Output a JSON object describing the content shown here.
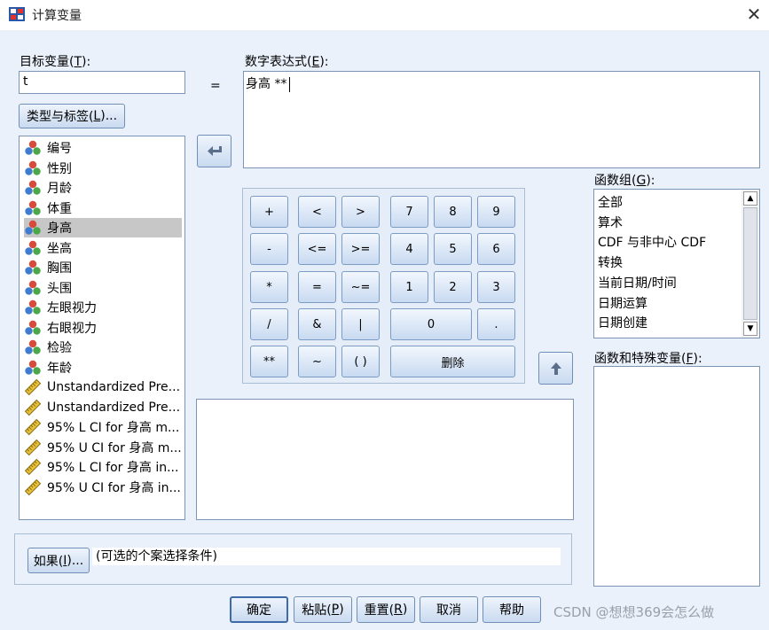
{
  "window": {
    "title": "计算变量"
  },
  "target": {
    "label": "目标变量(T):",
    "value": "t",
    "type_button": "类型与标签(L)..."
  },
  "equals": "=",
  "expression": {
    "label": "数字表达式(E):",
    "value": "身高 **"
  },
  "variables": [
    {
      "name": "编号",
      "kind": "nominal"
    },
    {
      "name": "性别",
      "kind": "nominal"
    },
    {
      "name": "月龄",
      "kind": "nominal"
    },
    {
      "name": "体重",
      "kind": "nominal"
    },
    {
      "name": "身高",
      "kind": "nominal",
      "selected": true
    },
    {
      "name": "坐高",
      "kind": "nominal"
    },
    {
      "name": "胸围",
      "kind": "nominal"
    },
    {
      "name": "头围",
      "kind": "nominal"
    },
    {
      "name": "左眼视力",
      "kind": "nominal"
    },
    {
      "name": "右眼视力",
      "kind": "nominal"
    },
    {
      "name": "检验",
      "kind": "nominal"
    },
    {
      "name": "年龄",
      "kind": "nominal"
    },
    {
      "name": "Unstandardized Pre...",
      "kind": "scale"
    },
    {
      "name": "Unstandardized Pre...",
      "kind": "scale"
    },
    {
      "name": "95% L CI for 身高 m...",
      "kind": "scale"
    },
    {
      "name": "95% U CI for 身高 m...",
      "kind": "scale"
    },
    {
      "name": "95% L CI for 身高 in...",
      "kind": "scale"
    },
    {
      "name": "95% U CI for 身高 in...",
      "kind": "scale"
    }
  ],
  "keypad": {
    "plus": "+",
    "lt": "<",
    "gt": ">",
    "k7": "7",
    "k8": "8",
    "k9": "9",
    "minus": "-",
    "le": "<=",
    "ge": ">=",
    "k4": "4",
    "k5": "5",
    "k6": "6",
    "mul": "*",
    "eq": "=",
    "ne": "~=",
    "k1": "1",
    "k2": "2",
    "k3": "3",
    "div": "/",
    "and": "&",
    "or": "|",
    "k0": "0",
    "dot": ".",
    "pow": "**",
    "not": "~",
    "paren": "( )",
    "delete": "删除"
  },
  "function_group": {
    "label": "函数组(G):",
    "items": [
      "全部",
      "算术",
      "CDF 与非中心 CDF",
      "转换",
      "当前日期/时间",
      "日期运算",
      "日期创建"
    ]
  },
  "functions": {
    "label": "函数和特殊变量(F):"
  },
  "if_section": {
    "button": "如果(I)...",
    "text": "(可选的个案选择条件)"
  },
  "footer": {
    "ok": "确定",
    "paste": "粘贴(P)",
    "reset": "重置(R)",
    "cancel": "取消",
    "help": "帮助",
    "watermark": "CSDN @想想369会怎么做"
  }
}
